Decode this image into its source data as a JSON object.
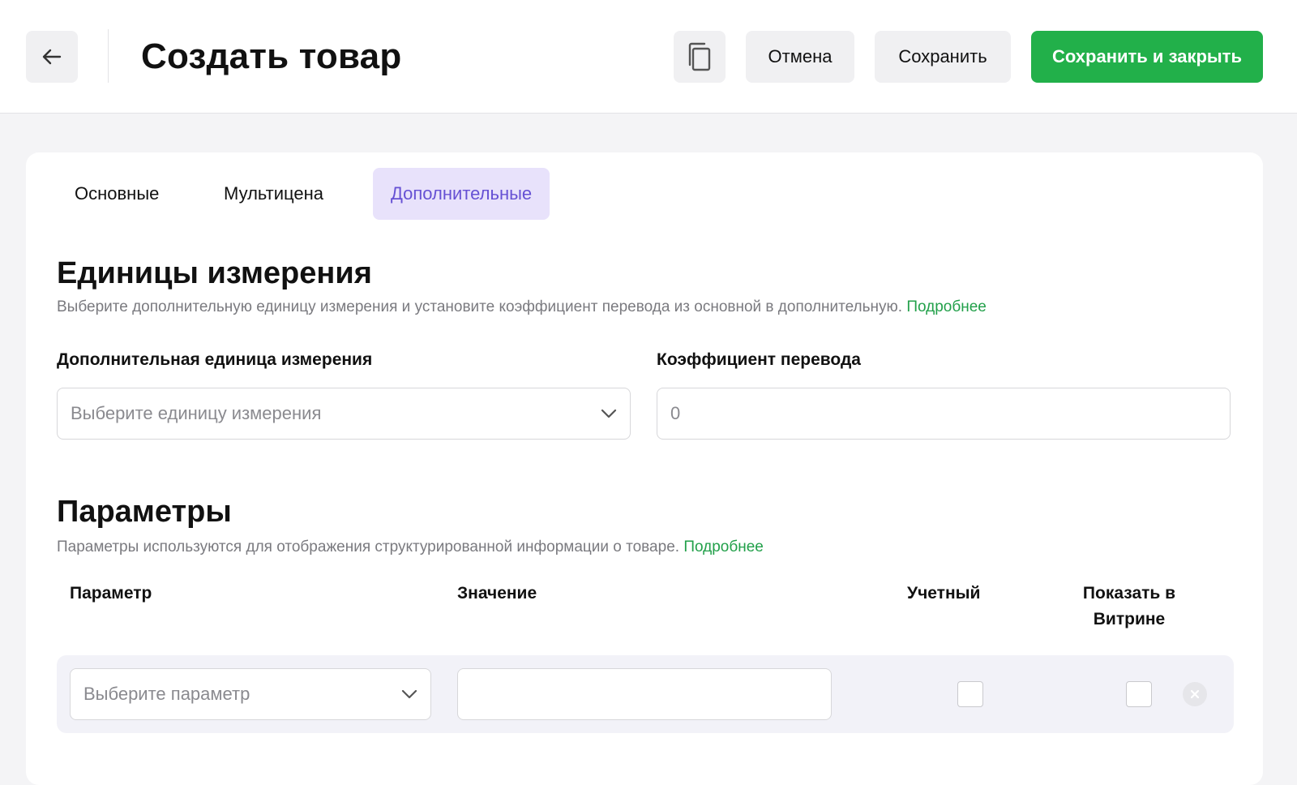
{
  "header": {
    "title": "Создать товар",
    "buttons": {
      "cancel": "Отмена",
      "save": "Сохранить",
      "save_close": "Сохранить и закрыть"
    }
  },
  "tabs": [
    {
      "label": "Основные",
      "active": false
    },
    {
      "label": "Мультицена",
      "active": false
    },
    {
      "label": "Дополнительные",
      "active": true
    }
  ],
  "units": {
    "title": "Единицы измерения",
    "description": "Выберите дополнительную единицу измерения и установите коэффициент перевода из основной в дополнительную.",
    "more_link": "Подробнее",
    "unit_label": "Дополнительная единица измерения",
    "unit_placeholder": "Выберите единицу измерения",
    "coef_label": "Коэффициент перевода",
    "coef_value": "0"
  },
  "params": {
    "title": "Параметры",
    "description": "Параметры используются для отображения структурированной информации о товаре.",
    "more_link": "Подробнее",
    "columns": {
      "param": "Параметр",
      "value": "Значение",
      "accounting": "Учетный",
      "show_line1": "Показать в",
      "show_line2": "Витрине"
    },
    "row": {
      "param_placeholder": "Выберите параметр",
      "value": ""
    }
  },
  "colors": {
    "accent_green": "#22b04a",
    "tab_active_bg": "#e8e2fb",
    "tab_active_text": "#6651d4"
  }
}
